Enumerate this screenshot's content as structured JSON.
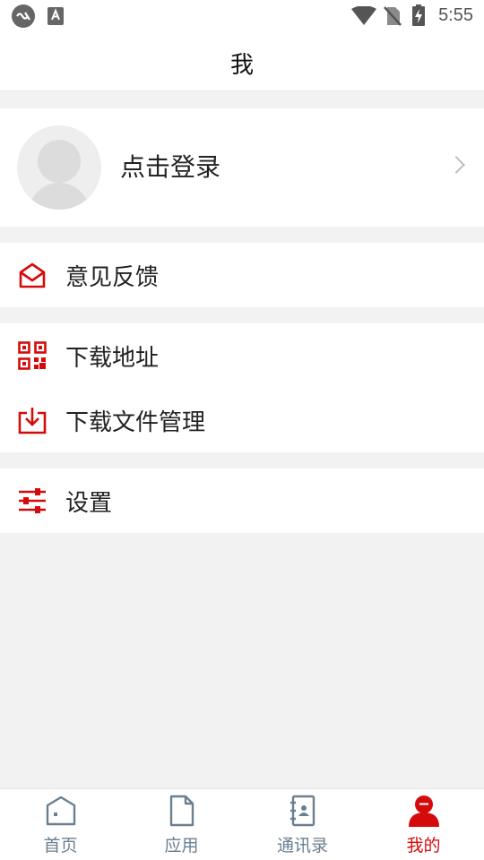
{
  "status_bar": {
    "time": "5:55"
  },
  "header": {
    "title": "我"
  },
  "profile": {
    "login_label": "点击登录"
  },
  "menu": {
    "feedback": "意见反馈",
    "download_address": "下载地址",
    "download_manager": "下载文件管理",
    "settings": "设置"
  },
  "tabs": [
    {
      "label": "首页",
      "icon": "home-icon"
    },
    {
      "label": "应用",
      "icon": "document-icon"
    },
    {
      "label": "通讯录",
      "icon": "contacts-icon"
    },
    {
      "label": "我的",
      "icon": "user-icon",
      "active": true
    }
  ],
  "colors": {
    "accent": "#d50b0b",
    "tab_inactive": "#6a7f90",
    "background": "#f2f2f2"
  }
}
